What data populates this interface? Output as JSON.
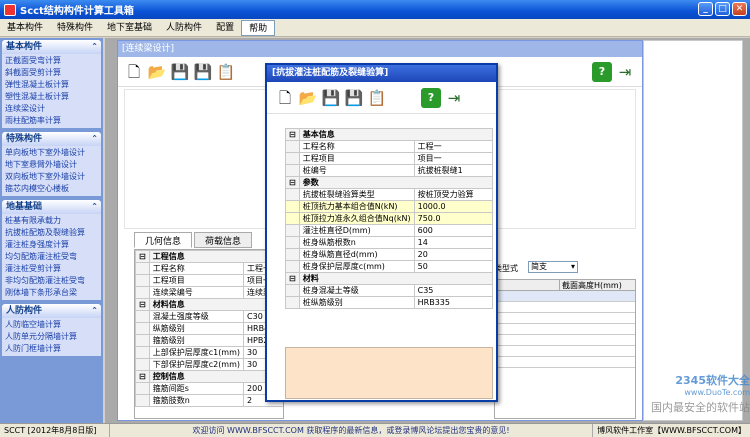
{
  "window": {
    "title": "Scct结构构件计算工具箱"
  },
  "menu": [
    "基本构件",
    "特殊构件",
    "地下室基础",
    "人防构件",
    "配置",
    "帮助"
  ],
  "sidebar": [
    {
      "title": "基本构件",
      "items": [
        "正截面受弯计算",
        "斜截面受剪计算",
        "弹性混凝土板计算",
        "塑性混凝土板计算",
        "连续梁设计",
        "雨柱配筋率计算"
      ]
    },
    {
      "title": "特殊构件",
      "items": [
        "单向板地下室外墙设计",
        "地下室悬臂外墙设计",
        "双向板地下室外墙设计",
        "箍芯内模空心楼板"
      ]
    },
    {
      "title": "地基基础",
      "items": [
        "桩基有限承载力",
        "抗拔桩配筋及裂缝验算",
        "灌注桩身强度计算",
        "均匀配筋灌注桩受弯",
        "灌注桩受剪计算",
        "非均匀配筋灌注桩受弯",
        "刚体墙下条形承台梁"
      ]
    },
    {
      "title": "人防构件",
      "items": [
        "人防临空墙计算",
        "人防单元分隔墙计算",
        "人防门框墙计算"
      ]
    }
  ],
  "main_window": {
    "title": "[连续梁设计]",
    "tabs": [
      "几何信息",
      "荷载信息"
    ],
    "type_label": "类型式",
    "type_value": "简支",
    "right_col_header": "截面高度H(mm)",
    "table": [
      {
        "section": "工程信息"
      },
      {
        "label": "工程名称",
        "value": "工程一"
      },
      {
        "label": "工程项目",
        "value": "项目一"
      },
      {
        "label": "连续梁编号",
        "value": "连续梁1"
      },
      {
        "section": "材料信息"
      },
      {
        "label": "混凝土强度等级",
        "value": "C30"
      },
      {
        "label": "纵筋级别",
        "value": "HRB400"
      },
      {
        "label": "箍筋级别",
        "value": "HPB235"
      },
      {
        "label": "上部保护层厚度c1(mm)",
        "value": "30"
      },
      {
        "label": "下部保护层厚度c2(mm)",
        "value": "30"
      },
      {
        "section": "控制信息"
      },
      {
        "label": "箍筋间距s",
        "value": "200"
      },
      {
        "label": "箍筋肢数n",
        "value": "2"
      }
    ]
  },
  "popup": {
    "title": "[抗拔灌注桩配筋及裂缝验算]",
    "table": [
      {
        "section": "基本信息"
      },
      {
        "label": "工程名称",
        "value": "工程一"
      },
      {
        "label": "工程项目",
        "value": "项目一"
      },
      {
        "label": "桩编号",
        "value": "抗拔桩裂缝1"
      },
      {
        "section": "参数"
      },
      {
        "label": "抗拔桩裂缝验算类型",
        "value": "按桩顶受力验算"
      },
      {
        "label": "桩顶抗力基本组合值N(kN)",
        "value": "1000.0",
        "hl": true
      },
      {
        "label": "桩顶拉力准永久组合值Nq(kN)",
        "value": "750.0",
        "hl": true
      },
      {
        "label": "灌注桩直径D(mm)",
        "value": "600"
      },
      {
        "label": "桩身纵筋根数n",
        "value": "14"
      },
      {
        "label": "桩身纵筋直径d(mm)",
        "value": "20"
      },
      {
        "label": "桩身保护层厚度c(mm)",
        "value": "50"
      },
      {
        "section": "材料"
      },
      {
        "label": "桩身混凝土等级",
        "value": "C35"
      },
      {
        "label": "桩纵筋级别",
        "value": "HRB335"
      }
    ]
  },
  "status": {
    "version": "SCCT [2012年8月8日版]",
    "message": "欢迎访问 WWW.BFSCCT.COM 获取程序的最新信息，或登录博风论坛提出您宝贵的意见!",
    "studio": "博风软件工作室【WWW.BFSCCT.COM】"
  },
  "watermark": {
    "line1": "2345软件大全",
    "line2": "www.DuoTe.com",
    "line3": "国内最安全的软件站"
  },
  "icons": {
    "toolbar": [
      "new-file-icon",
      "open-folder-icon",
      "save-icon",
      "save-as-icon",
      "clipboard-icon"
    ],
    "help": "help-icon",
    "exit": "exit-icon"
  }
}
